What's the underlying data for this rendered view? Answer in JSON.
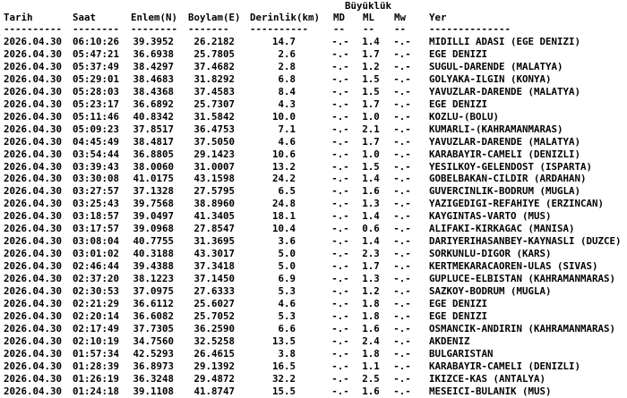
{
  "header": {
    "group_title": "Büyüklük",
    "columns": {
      "date": "Tarih",
      "time": "Saat",
      "lat": "Enlem(N)",
      "lon": "Boylam(E)",
      "depth": "Derinlik(km)",
      "md": "MD",
      "ml": "ML",
      "mw": "Mw",
      "location": "Yer"
    },
    "separators": {
      "date": "----------",
      "time": "--------",
      "lat": "--------",
      "lon": "-------",
      "depth": "----------",
      "md": "--",
      "ml": "--",
      "mw": "--",
      "location": "--------------"
    }
  },
  "rows": [
    {
      "date": "2026.04.30",
      "time": "06:10:26",
      "lat": "39.3952",
      "lon": "26.2182",
      "depth": "14.7",
      "md": "-.-",
      "ml": "1.4",
      "mw": "-.-",
      "location": "MIDILLI ADASI (EGE DENIZI)"
    },
    {
      "date": "2026.04.30",
      "time": "05:47:21",
      "lat": "36.6938",
      "lon": "25.7805",
      "depth": "2.6",
      "md": "-.-",
      "ml": "1.7",
      "mw": "-.-",
      "location": "EGE DENIZI"
    },
    {
      "date": "2026.04.30",
      "time": "05:37:49",
      "lat": "38.4297",
      "lon": "37.4682",
      "depth": "2.8",
      "md": "-.-",
      "ml": "1.2",
      "mw": "-.-",
      "location": "SUGUL-DARENDE (MALATYA)"
    },
    {
      "date": "2026.04.30",
      "time": "05:29:01",
      "lat": "38.4683",
      "lon": "31.8292",
      "depth": "6.8",
      "md": "-.-",
      "ml": "1.5",
      "mw": "-.-",
      "location": "GOLYAKA-ILGIN (KONYA)"
    },
    {
      "date": "2026.04.30",
      "time": "05:28:03",
      "lat": "38.4368",
      "lon": "37.4583",
      "depth": "8.4",
      "md": "-.-",
      "ml": "1.5",
      "mw": "-.-",
      "location": "YAVUZLAR-DARENDE (MALATYA)"
    },
    {
      "date": "2026.04.30",
      "time": "05:23:17",
      "lat": "36.6892",
      "lon": "25.7307",
      "depth": "4.3",
      "md": "-.-",
      "ml": "1.7",
      "mw": "-.-",
      "location": "EGE DENIZI"
    },
    {
      "date": "2026.04.30",
      "time": "05:11:46",
      "lat": "40.8342",
      "lon": "31.5842",
      "depth": "10.0",
      "md": "-.-",
      "ml": "1.0",
      "mw": "-.-",
      "location": "KOZLU-(BOLU)"
    },
    {
      "date": "2026.04.30",
      "time": "05:09:23",
      "lat": "37.8517",
      "lon": "36.4753",
      "depth": "7.1",
      "md": "-.-",
      "ml": "2.1",
      "mw": "-.-",
      "location": "KUMARLI-(KAHRAMANMARAS)"
    },
    {
      "date": "2026.04.30",
      "time": "04:45:49",
      "lat": "38.4817",
      "lon": "37.5050",
      "depth": "4.6",
      "md": "-.-",
      "ml": "1.7",
      "mw": "-.-",
      "location": "YAVUZLAR-DARENDE (MALATYA)"
    },
    {
      "date": "2026.04.30",
      "time": "03:54:44",
      "lat": "36.8805",
      "lon": "29.1423",
      "depth": "10.6",
      "md": "-.-",
      "ml": "1.0",
      "mw": "-.-",
      "location": "KARABAYIR-CAMELI (DENIZLI)"
    },
    {
      "date": "2026.04.30",
      "time": "03:39:43",
      "lat": "38.0060",
      "lon": "31.0007",
      "depth": "13.2",
      "md": "-.-",
      "ml": "1.5",
      "mw": "-.-",
      "location": "YESILKOY-GELENDOST (ISPARTA)"
    },
    {
      "date": "2026.04.30",
      "time": "03:30:08",
      "lat": "41.0175",
      "lon": "43.1598",
      "depth": "24.2",
      "md": "-.-",
      "ml": "1.4",
      "mw": "-.-",
      "location": "GOBELBAKAN-CILDIR (ARDAHAN)"
    },
    {
      "date": "2026.04.30",
      "time": "03:27:57",
      "lat": "37.1328",
      "lon": "27.5795",
      "depth": "6.5",
      "md": "-.-",
      "ml": "1.6",
      "mw": "-.-",
      "location": "GUVERCINLIK-BODRUM (MUGLA)"
    },
    {
      "date": "2026.04.30",
      "time": "03:25:43",
      "lat": "39.7568",
      "lon": "38.8960",
      "depth": "24.8",
      "md": "-.-",
      "ml": "1.3",
      "mw": "-.-",
      "location": "YAZIGEDIGI-REFAHIYE (ERZINCAN)"
    },
    {
      "date": "2026.04.30",
      "time": "03:18:57",
      "lat": "39.0497",
      "lon": "41.3405",
      "depth": "18.1",
      "md": "-.-",
      "ml": "1.4",
      "mw": "-.-",
      "location": "KAYGINTAS-VARTO (MUS)"
    },
    {
      "date": "2026.04.30",
      "time": "03:17:57",
      "lat": "39.0968",
      "lon": "27.8547",
      "depth": "10.4",
      "md": "-.-",
      "ml": "0.6",
      "mw": "-.-",
      "location": "ALIFAKI-KIRKAGAC (MANISA)"
    },
    {
      "date": "2026.04.30",
      "time": "03:08:04",
      "lat": "40.7755",
      "lon": "31.3695",
      "depth": "3.6",
      "md": "-.-",
      "ml": "1.4",
      "mw": "-.-",
      "location": "DARIYERIHASANBEY-KAYNASLI (DUZCE)"
    },
    {
      "date": "2026.04.30",
      "time": "03:01:02",
      "lat": "40.3188",
      "lon": "43.3017",
      "depth": "5.0",
      "md": "-.-",
      "ml": "2.3",
      "mw": "-.-",
      "location": "SORKUNLU-DIGOR (KARS)"
    },
    {
      "date": "2026.04.30",
      "time": "02:46:44",
      "lat": "39.4388",
      "lon": "37.3418",
      "depth": "5.0",
      "md": "-.-",
      "ml": "1.7",
      "mw": "-.-",
      "location": "KERTMEKARACAOREN-ULAS (SIVAS)"
    },
    {
      "date": "2026.04.30",
      "time": "02:37:20",
      "lat": "38.1223",
      "lon": "37.1450",
      "depth": "6.9",
      "md": "-.-",
      "ml": "1.3",
      "mw": "-.-",
      "location": "GUPLUCE-ELBISTAN (KAHRAMANMARAS)"
    },
    {
      "date": "2026.04.30",
      "time": "02:30:53",
      "lat": "37.0975",
      "lon": "27.6333",
      "depth": "5.3",
      "md": "-.-",
      "ml": "1.2",
      "mw": "-.-",
      "location": "SAZKOY-BODRUM (MUGLA)"
    },
    {
      "date": "2026.04.30",
      "time": "02:21:29",
      "lat": "36.6112",
      "lon": "25.6027",
      "depth": "4.6",
      "md": "-.-",
      "ml": "1.8",
      "mw": "-.-",
      "location": "EGE DENIZI"
    },
    {
      "date": "2026.04.30",
      "time": "02:20:14",
      "lat": "36.6082",
      "lon": "25.7052",
      "depth": "5.3",
      "md": "-.-",
      "ml": "1.8",
      "mw": "-.-",
      "location": "EGE DENIZI"
    },
    {
      "date": "2026.04.30",
      "time": "02:17:49",
      "lat": "37.7305",
      "lon": "36.2590",
      "depth": "6.6",
      "md": "-.-",
      "ml": "1.6",
      "mw": "-.-",
      "location": "OSMANCIK-ANDIRIN (KAHRAMANMARAS)"
    },
    {
      "date": "2026.04.30",
      "time": "02:10:19",
      "lat": "34.7560",
      "lon": "32.5258",
      "depth": "13.5",
      "md": "-.-",
      "ml": "2.4",
      "mw": "-.-",
      "location": "AKDENIZ"
    },
    {
      "date": "2026.04.30",
      "time": "01:57:34",
      "lat": "42.5293",
      "lon": "26.4615",
      "depth": "3.8",
      "md": "-.-",
      "ml": "1.8",
      "mw": "-.-",
      "location": "BULGARISTAN"
    },
    {
      "date": "2026.04.30",
      "time": "01:28:39",
      "lat": "36.8973",
      "lon": "29.1392",
      "depth": "16.5",
      "md": "-.-",
      "ml": "1.1",
      "mw": "-.-",
      "location": "KARABAYIR-CAMELI (DENIZLI)"
    },
    {
      "date": "2026.04.30",
      "time": "01:26:19",
      "lat": "36.3248",
      "lon": "29.4872",
      "depth": "32.2",
      "md": "-.-",
      "ml": "2.5",
      "mw": "-.-",
      "location": "IKIZCE-KAS (ANTALYA)"
    },
    {
      "date": "2026.04.30",
      "time": "01:24:18",
      "lat": "39.1108",
      "lon": "41.8747",
      "depth": "15.5",
      "md": "-.-",
      "ml": "1.6",
      "mw": "-.-",
      "location": "MESEICI-BULANIK (MUS)"
    }
  ]
}
